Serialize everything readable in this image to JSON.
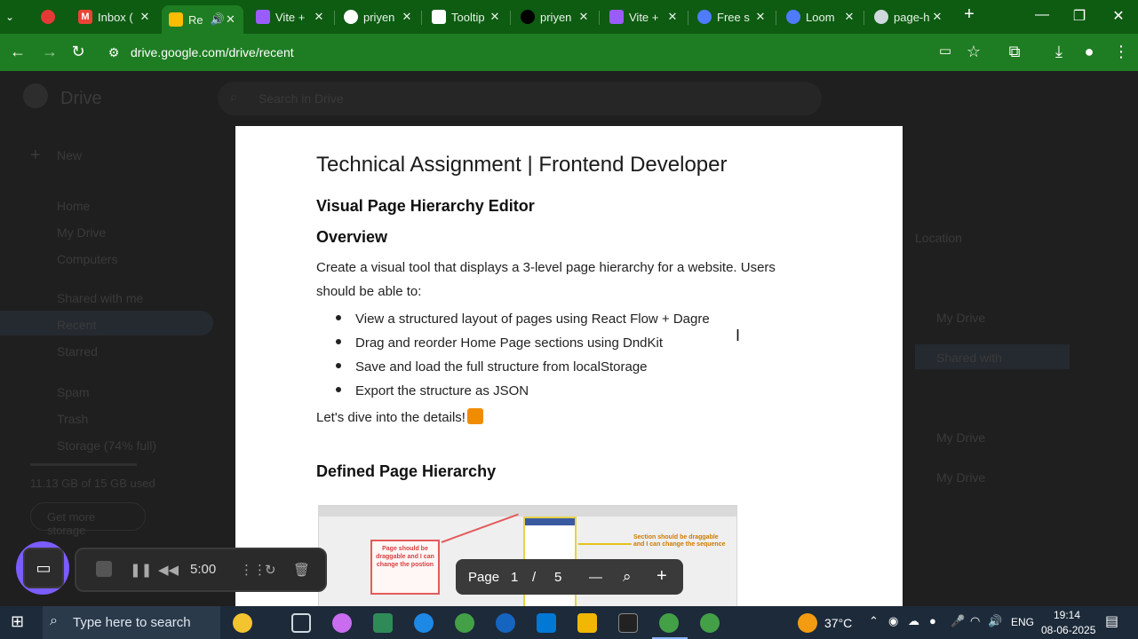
{
  "browser": {
    "tabs": [
      {
        "label": "",
        "icon": "record-icon",
        "color": "#e53935"
      },
      {
        "label": "Inbox (",
        "icon": "gmail-icon",
        "color": "#ea4335"
      },
      {
        "label": "Re",
        "icon": "drive-icon",
        "color": "#fbbc04",
        "active": true
      },
      {
        "label": "Vite +",
        "icon": "vite-icon",
        "color": "#9b5cff"
      },
      {
        "label": "priyen",
        "icon": "github-icon",
        "color": "#ffffff"
      },
      {
        "label": "Tooltip",
        "icon": "tooltip-icon",
        "color": "#ffffff"
      },
      {
        "label": "priyen",
        "icon": "vercel-icon",
        "color": "#000000"
      },
      {
        "label": "Vite +",
        "icon": "vite-icon",
        "color": "#9b5cff"
      },
      {
        "label": "Free s",
        "icon": "gear-icon",
        "color": "#4f7cff"
      },
      {
        "label": "Loom",
        "icon": "loom-icon",
        "color": "#4f7cff"
      },
      {
        "label": "page-h",
        "icon": "globe-icon",
        "color": "#cfd8dc"
      }
    ],
    "new_tab": "+",
    "window": {
      "minimize": "—",
      "restore": "❐",
      "close": "✕"
    },
    "url": "drive.google.com/drive/recent"
  },
  "drive": {
    "logo": "Drive",
    "search_placeholder": "Search in Drive",
    "sidebar": [
      "New",
      "Home",
      "My Drive",
      "Computers",
      "Shared with me",
      "Recent",
      "Starred",
      "Spam",
      "Trash",
      "Storage (74% full)",
      "11.13 GB of 15 GB used",
      "Get more storage"
    ],
    "right_labels": [
      "Location",
      "My Drive",
      "Shared with",
      "My Drive",
      "My Drive"
    ]
  },
  "doc": {
    "title": "Technical Assignment | Frontend Developer",
    "subtitle": "Visual Page Hierarchy Editor",
    "overview_heading": "Overview",
    "overview_text": "Create a visual tool that displays a 3-level page hierarchy for a website. Users should be able to:",
    "bullets": [
      "View a structured layout of pages using React Flow + Dagre",
      "Drag and reorder Home Page sections using DndKit",
      "Save and load the full structure from localStorage",
      "Export the structure as JSON"
    ],
    "dive_text": "Let's dive into the details!",
    "section_heading": "Defined Page Hierarchy",
    "embed": {
      "card_text": "Page should be draggable and I can change the postion",
      "note_text": "Section should be draggable and I can change the sequence"
    }
  },
  "pager": {
    "label": "Page",
    "current": "1",
    "separator": "/",
    "total": "5",
    "zoom_out": "—",
    "zoom_in": "+"
  },
  "recorder": {
    "time": "5:00"
  },
  "taskbar": {
    "search_placeholder": "Type here to search",
    "weather": "37°C",
    "language": "ENG",
    "time": "19:14",
    "date": "08-06-2025"
  }
}
